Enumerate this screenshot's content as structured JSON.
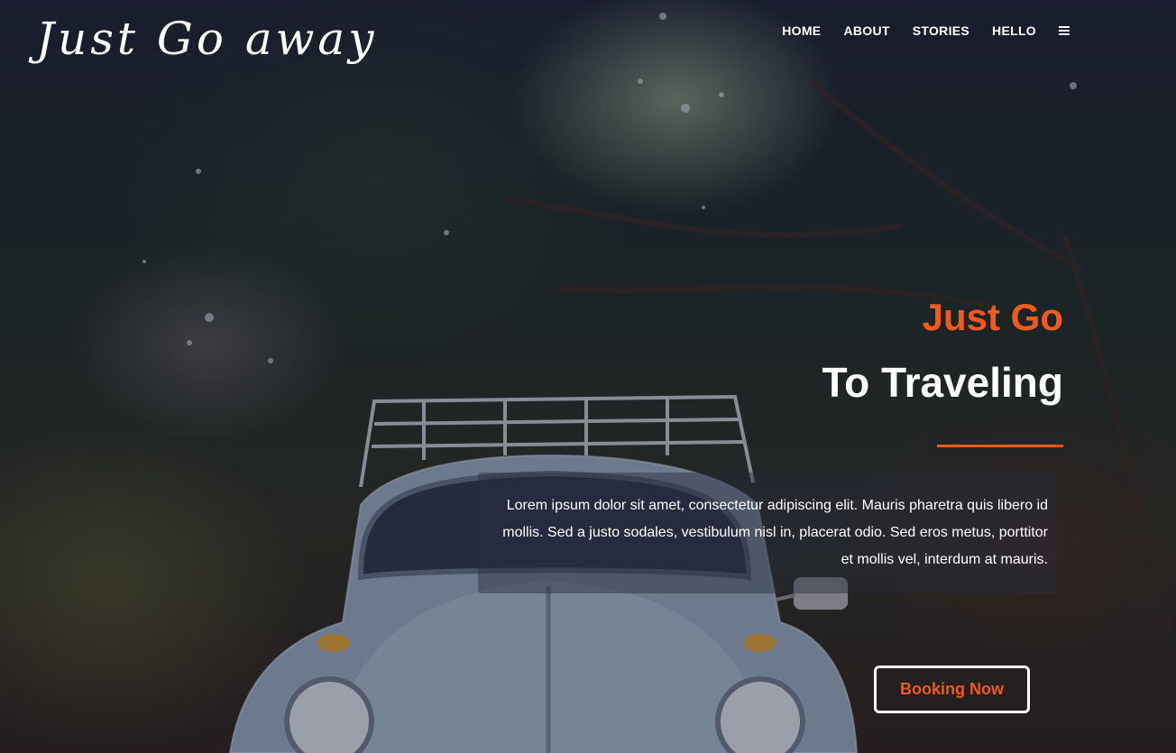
{
  "header": {
    "logo_text": "Just Go away",
    "nav": [
      {
        "label": "HOME"
      },
      {
        "label": "ABOUT"
      },
      {
        "label": "STORIES"
      },
      {
        "label": "HELLO"
      }
    ],
    "menu_icon": "hamburger-menu-icon"
  },
  "hero": {
    "title_line1": "Just Go",
    "title_line2": "To Traveling",
    "description": "Lorem ipsum dolor sit amet, consectetur adipiscing elit. Mauris pharetra quis libero id mollis. Sed a justo sodales, vestibulum nisl in, placerat odio. Sed eros metus, porttitor et mollis vel, interdum at mauris.",
    "button_label": "Booking Now",
    "background_image": "vintage-car-under-trees"
  },
  "colors": {
    "accent": "#f05a1a",
    "text": "#ffffff"
  }
}
